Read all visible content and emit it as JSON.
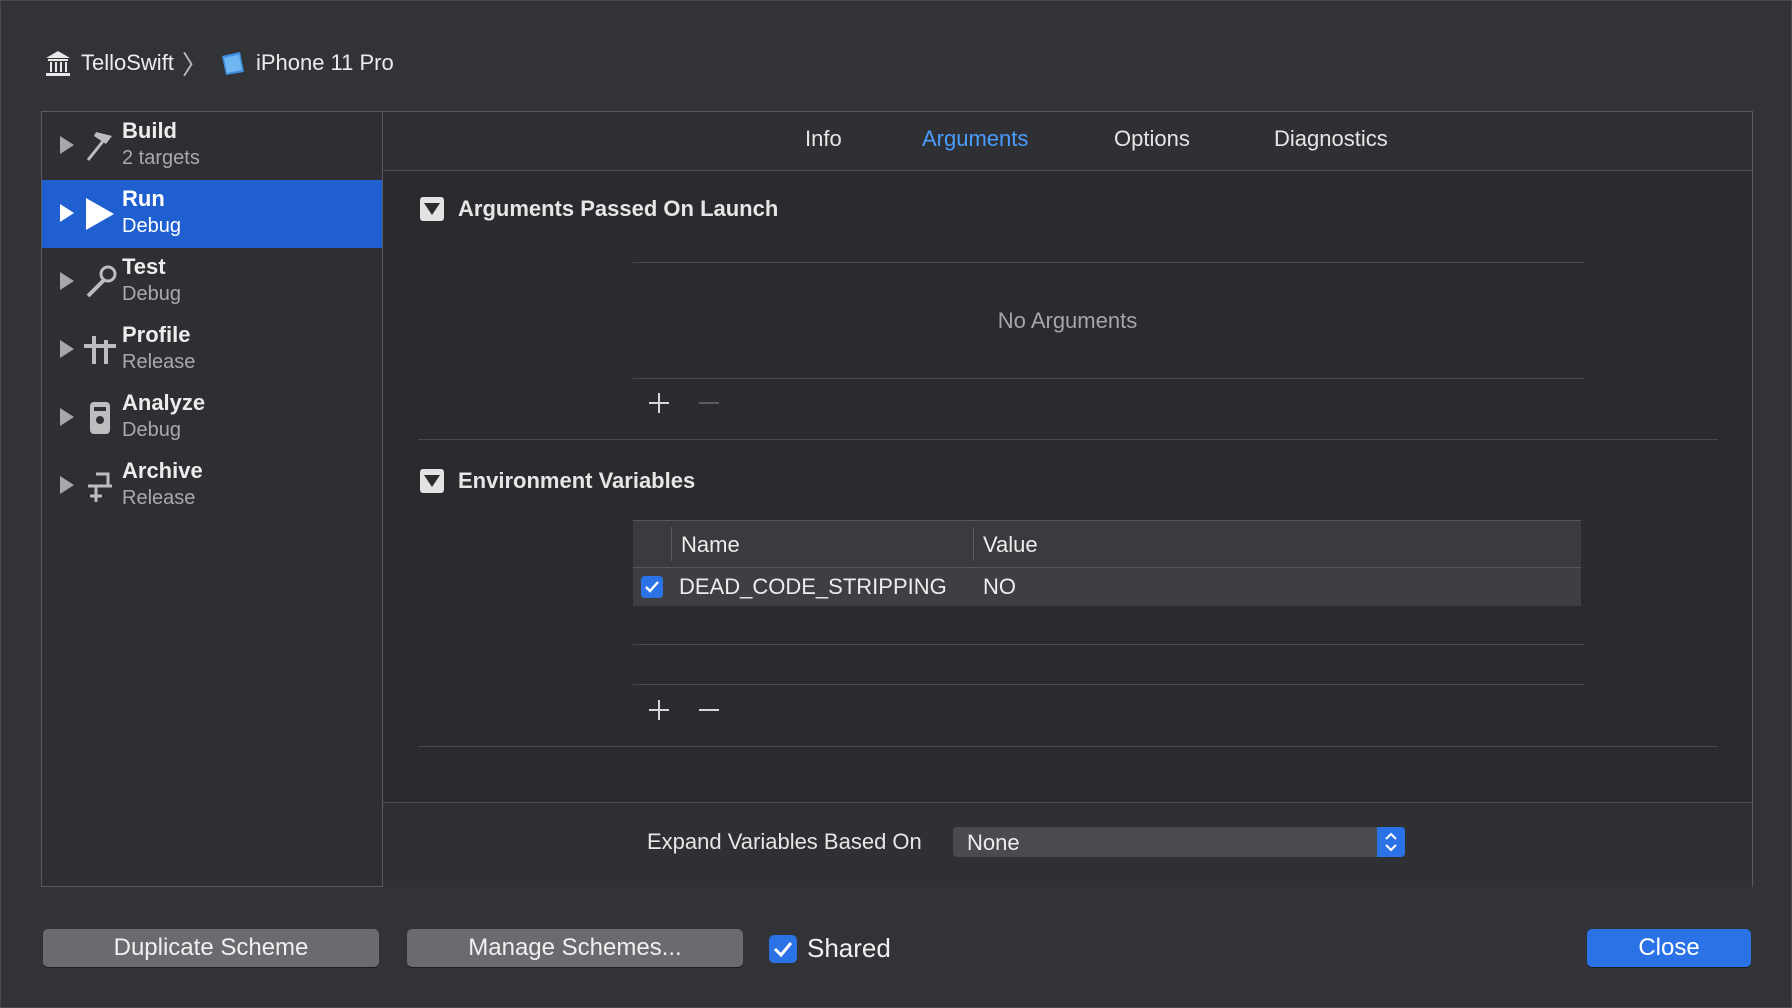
{
  "breadcrumb": {
    "project": "TelloSwift",
    "device": "iPhone 11 Pro"
  },
  "sidebar": {
    "items": [
      {
        "title": "Build",
        "subtitle": "2 targets",
        "icon": "hammer-icon",
        "selected": false
      },
      {
        "title": "Run",
        "subtitle": "Debug",
        "icon": "play-icon",
        "selected": true
      },
      {
        "title": "Test",
        "subtitle": "Debug",
        "icon": "wrench-icon",
        "selected": false
      },
      {
        "title": "Profile",
        "subtitle": "Release",
        "icon": "instruments-icon",
        "selected": false
      },
      {
        "title": "Analyze",
        "subtitle": "Debug",
        "icon": "analyze-icon",
        "selected": false
      },
      {
        "title": "Archive",
        "subtitle": "Release",
        "icon": "archive-icon",
        "selected": false
      }
    ]
  },
  "tabs": [
    {
      "label": "Info",
      "active": false
    },
    {
      "label": "Arguments",
      "active": true
    },
    {
      "label": "Options",
      "active": false
    },
    {
      "label": "Diagnostics",
      "active": false
    }
  ],
  "arguments": {
    "section_title": "Arguments Passed On Launch",
    "empty_text": "No Arguments"
  },
  "environment": {
    "section_title": "Environment Variables",
    "col_name": "Name",
    "col_value": "Value",
    "rows": [
      {
        "enabled": true,
        "name": "DEAD_CODE_STRIPPING",
        "value": "NO"
      }
    ]
  },
  "expand": {
    "label": "Expand Variables Based On",
    "selected": "None"
  },
  "footer": {
    "duplicate_label": "Duplicate Scheme",
    "manage_label": "Manage Schemes...",
    "shared_label": "Shared",
    "shared_checked": true,
    "close_label": "Close"
  },
  "colors": {
    "accent": "#2a72e6",
    "selection": "#1f5fd0",
    "active_tab": "#4a9cff",
    "background": "#323337"
  }
}
